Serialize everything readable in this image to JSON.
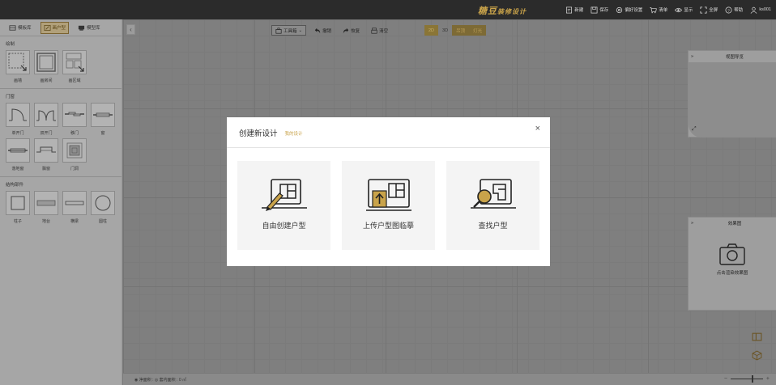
{
  "brand": {
    "name": "糖豆",
    "suffix": "装修设计"
  },
  "top_menu": [
    {
      "label": "新建",
      "icon": "new-file-icon"
    },
    {
      "label": "保存",
      "icon": "save-icon"
    },
    {
      "label": "偏好设置",
      "icon": "settings-icon"
    },
    {
      "label": "清单",
      "icon": "cart-icon"
    },
    {
      "label": "显示",
      "icon": "eye-icon"
    },
    {
      "label": "全屏",
      "icon": "fullscreen-icon"
    },
    {
      "label": "帮助",
      "icon": "help-icon"
    },
    {
      "label": "ks001",
      "icon": "user-icon"
    }
  ],
  "left_tabs": [
    {
      "label": "模板库",
      "active": false
    },
    {
      "label": "画户型",
      "active": true
    },
    {
      "label": "模型库",
      "active": false
    }
  ],
  "sections": {
    "draw": {
      "title": "绘制",
      "tools": [
        "画墙",
        "画房间",
        "画区域"
      ]
    },
    "doors": {
      "title": "门窗",
      "tools": [
        "单开门",
        "双开门",
        "移门",
        "窗",
        "落地窗",
        "飘窗",
        "门洞"
      ]
    },
    "struct": {
      "title": "结构部件",
      "tools": [
        "柱子",
        "地台",
        "横梁",
        "圆柱"
      ]
    }
  },
  "toolbar": {
    "toolbox": "工具箱",
    "undo": "撤销",
    "redo": "恢复",
    "clear": "清空",
    "view_modes": [
      "2D",
      "3D",
      "吊顶",
      "灯光"
    ],
    "active_view": "2D"
  },
  "nav_panel": {
    "title": "视图导览"
  },
  "effect_panel": {
    "title": "效果图",
    "action": "点击渲染效果图"
  },
  "status": {
    "text": "◉ 净面积 : ◎ 套内面积 : 0 ㎡"
  },
  "dialog": {
    "title": "创建新设计",
    "subtitle": "我的设计",
    "close": "×",
    "cards": [
      {
        "label": "自由创建户型",
        "icon": "floorplan-pencil-icon"
      },
      {
        "label": "上传户型图临摹",
        "icon": "floorplan-upload-icon"
      },
      {
        "label": "查找户型",
        "icon": "floorplan-search-icon"
      }
    ]
  },
  "colors": {
    "accent": "#c9a34a",
    "topbar": "#2b2b2b",
    "overlay": "#7f7f7f"
  }
}
